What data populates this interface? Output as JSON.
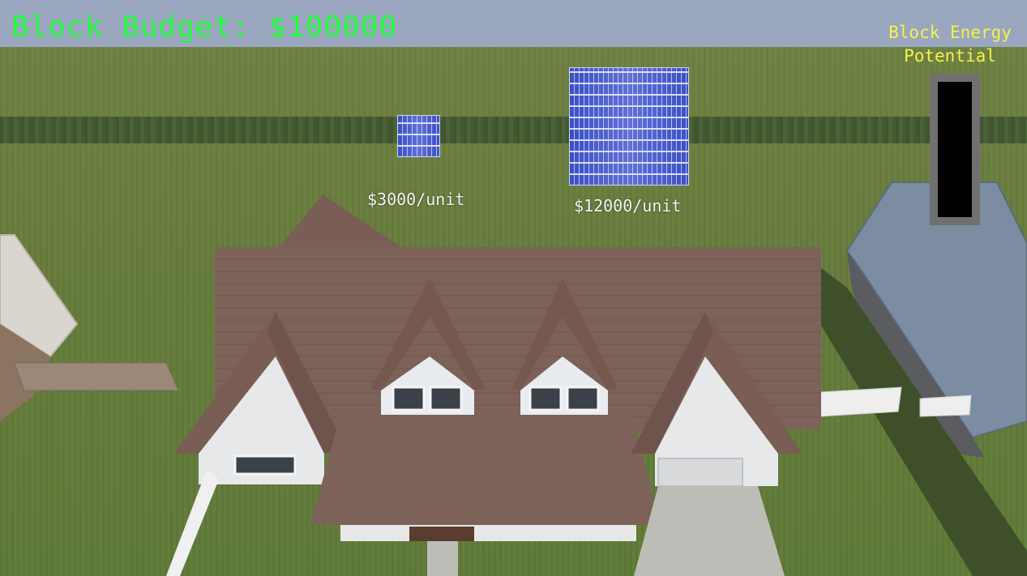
{
  "hud": {
    "budget_label": "Block Budget: $100000",
    "energy_label": "Block Energy Potential",
    "energy_level_percent": 0
  },
  "shop": {
    "items": [
      {
        "price_label": "$3000/unit"
      },
      {
        "price_label": "$12000/unit"
      }
    ]
  },
  "colors": {
    "budget_text": "#1fff3a",
    "energy_text": "#f4f24c",
    "meter_frame": "#707070",
    "meter_empty": "#000000",
    "panel_blue": "#3a4fc6"
  }
}
